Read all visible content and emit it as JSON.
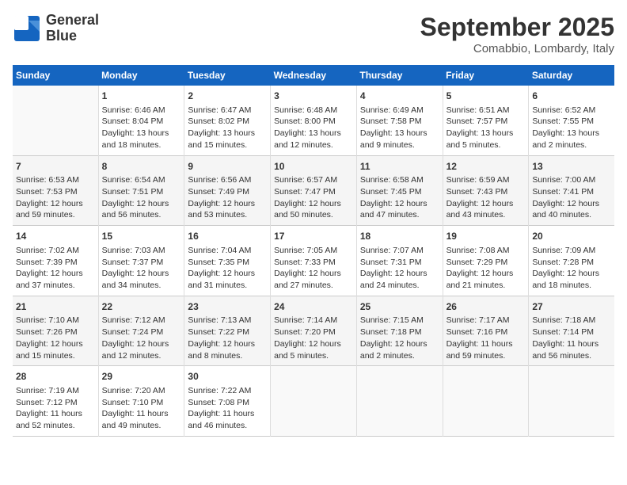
{
  "logo": {
    "line1": "General",
    "line2": "Blue"
  },
  "title": "September 2025",
  "location": "Comabbio, Lombardy, Italy",
  "headers": [
    "Sunday",
    "Monday",
    "Tuesday",
    "Wednesday",
    "Thursday",
    "Friday",
    "Saturday"
  ],
  "weeks": [
    [
      {
        "day": "",
        "content": ""
      },
      {
        "day": "1",
        "content": "Sunrise: 6:46 AM\nSunset: 8:04 PM\nDaylight: 13 hours\nand 18 minutes."
      },
      {
        "day": "2",
        "content": "Sunrise: 6:47 AM\nSunset: 8:02 PM\nDaylight: 13 hours\nand 15 minutes."
      },
      {
        "day": "3",
        "content": "Sunrise: 6:48 AM\nSunset: 8:00 PM\nDaylight: 13 hours\nand 12 minutes."
      },
      {
        "day": "4",
        "content": "Sunrise: 6:49 AM\nSunset: 7:58 PM\nDaylight: 13 hours\nand 9 minutes."
      },
      {
        "day": "5",
        "content": "Sunrise: 6:51 AM\nSunset: 7:57 PM\nDaylight: 13 hours\nand 5 minutes."
      },
      {
        "day": "6",
        "content": "Sunrise: 6:52 AM\nSunset: 7:55 PM\nDaylight: 13 hours\nand 2 minutes."
      }
    ],
    [
      {
        "day": "7",
        "content": "Sunrise: 6:53 AM\nSunset: 7:53 PM\nDaylight: 12 hours\nand 59 minutes."
      },
      {
        "day": "8",
        "content": "Sunrise: 6:54 AM\nSunset: 7:51 PM\nDaylight: 12 hours\nand 56 minutes."
      },
      {
        "day": "9",
        "content": "Sunrise: 6:56 AM\nSunset: 7:49 PM\nDaylight: 12 hours\nand 53 minutes."
      },
      {
        "day": "10",
        "content": "Sunrise: 6:57 AM\nSunset: 7:47 PM\nDaylight: 12 hours\nand 50 minutes."
      },
      {
        "day": "11",
        "content": "Sunrise: 6:58 AM\nSunset: 7:45 PM\nDaylight: 12 hours\nand 47 minutes."
      },
      {
        "day": "12",
        "content": "Sunrise: 6:59 AM\nSunset: 7:43 PM\nDaylight: 12 hours\nand 43 minutes."
      },
      {
        "day": "13",
        "content": "Sunrise: 7:00 AM\nSunset: 7:41 PM\nDaylight: 12 hours\nand 40 minutes."
      }
    ],
    [
      {
        "day": "14",
        "content": "Sunrise: 7:02 AM\nSunset: 7:39 PM\nDaylight: 12 hours\nand 37 minutes."
      },
      {
        "day": "15",
        "content": "Sunrise: 7:03 AM\nSunset: 7:37 PM\nDaylight: 12 hours\nand 34 minutes."
      },
      {
        "day": "16",
        "content": "Sunrise: 7:04 AM\nSunset: 7:35 PM\nDaylight: 12 hours\nand 31 minutes."
      },
      {
        "day": "17",
        "content": "Sunrise: 7:05 AM\nSunset: 7:33 PM\nDaylight: 12 hours\nand 27 minutes."
      },
      {
        "day": "18",
        "content": "Sunrise: 7:07 AM\nSunset: 7:31 PM\nDaylight: 12 hours\nand 24 minutes."
      },
      {
        "day": "19",
        "content": "Sunrise: 7:08 AM\nSunset: 7:29 PM\nDaylight: 12 hours\nand 21 minutes."
      },
      {
        "day": "20",
        "content": "Sunrise: 7:09 AM\nSunset: 7:28 PM\nDaylight: 12 hours\nand 18 minutes."
      }
    ],
    [
      {
        "day": "21",
        "content": "Sunrise: 7:10 AM\nSunset: 7:26 PM\nDaylight: 12 hours\nand 15 minutes."
      },
      {
        "day": "22",
        "content": "Sunrise: 7:12 AM\nSunset: 7:24 PM\nDaylight: 12 hours\nand 12 minutes."
      },
      {
        "day": "23",
        "content": "Sunrise: 7:13 AM\nSunset: 7:22 PM\nDaylight: 12 hours\nand 8 minutes."
      },
      {
        "day": "24",
        "content": "Sunrise: 7:14 AM\nSunset: 7:20 PM\nDaylight: 12 hours\nand 5 minutes."
      },
      {
        "day": "25",
        "content": "Sunrise: 7:15 AM\nSunset: 7:18 PM\nDaylight: 12 hours\nand 2 minutes."
      },
      {
        "day": "26",
        "content": "Sunrise: 7:17 AM\nSunset: 7:16 PM\nDaylight: 11 hours\nand 59 minutes."
      },
      {
        "day": "27",
        "content": "Sunrise: 7:18 AM\nSunset: 7:14 PM\nDaylight: 11 hours\nand 56 minutes."
      }
    ],
    [
      {
        "day": "28",
        "content": "Sunrise: 7:19 AM\nSunset: 7:12 PM\nDaylight: 11 hours\nand 52 minutes."
      },
      {
        "day": "29",
        "content": "Sunrise: 7:20 AM\nSunset: 7:10 PM\nDaylight: 11 hours\nand 49 minutes."
      },
      {
        "day": "30",
        "content": "Sunrise: 7:22 AM\nSunset: 7:08 PM\nDaylight: 11 hours\nand 46 minutes."
      },
      {
        "day": "",
        "content": ""
      },
      {
        "day": "",
        "content": ""
      },
      {
        "day": "",
        "content": ""
      },
      {
        "day": "",
        "content": ""
      }
    ]
  ]
}
